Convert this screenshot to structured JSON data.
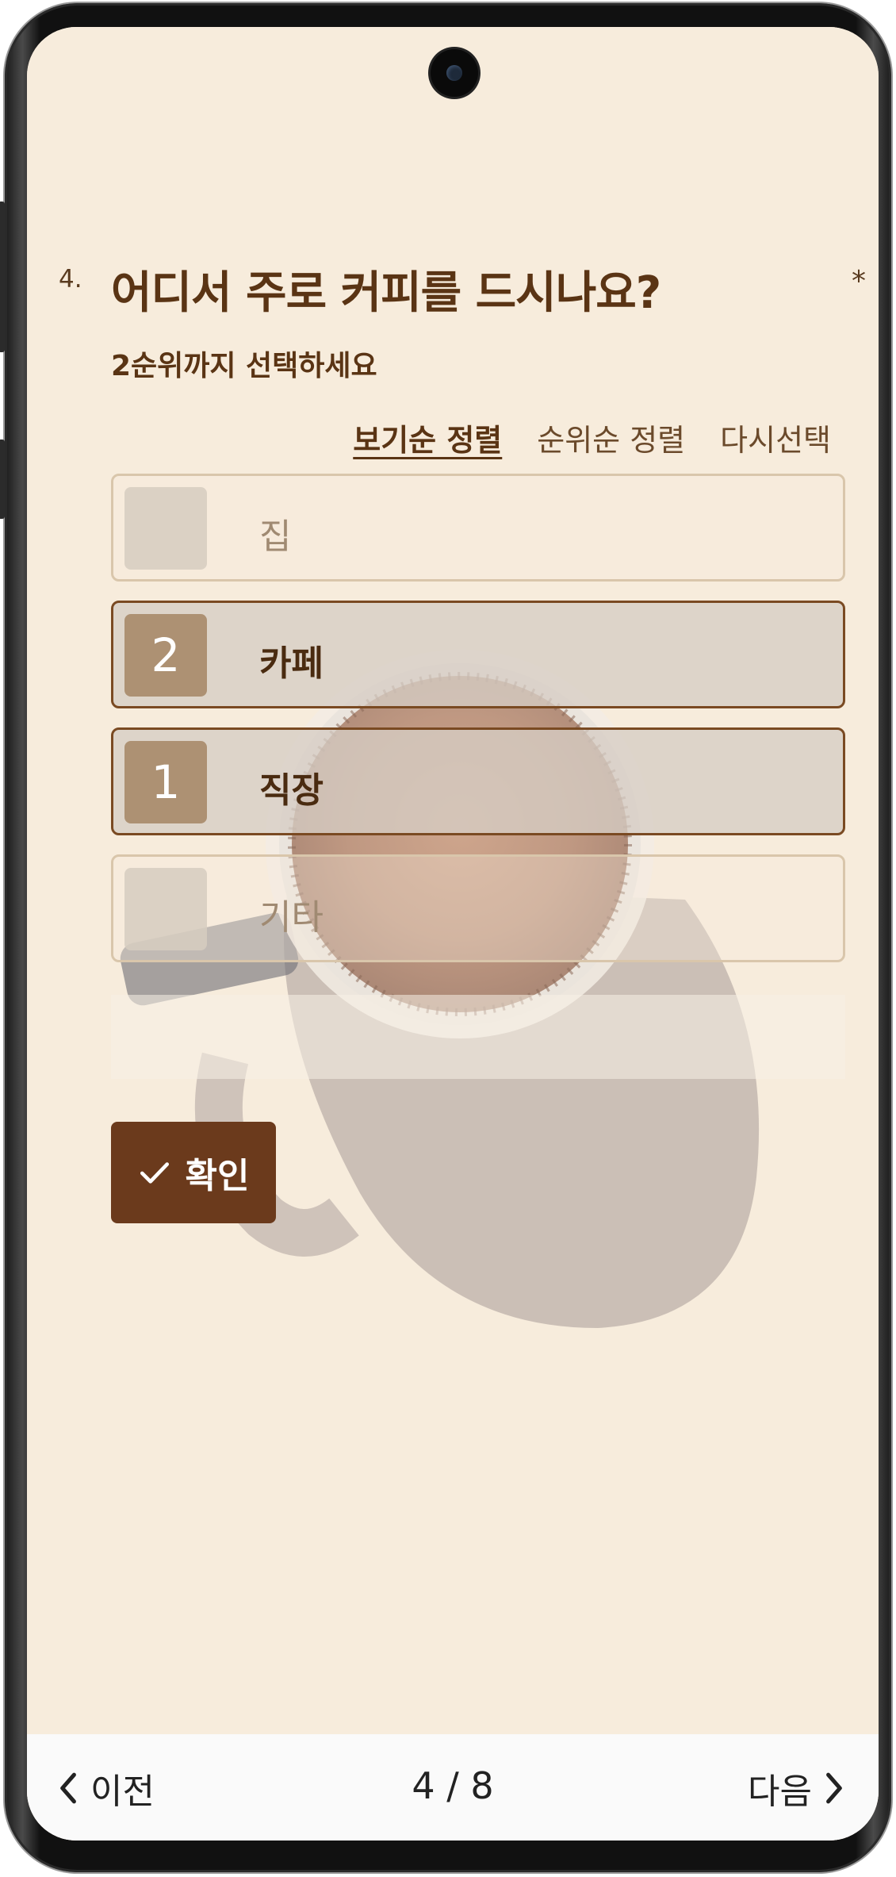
{
  "question": {
    "number": "4.",
    "title": "어디서 주로 커피를 드시나요?",
    "required_mark": "*",
    "hint": "2순위까지 선택하세요"
  },
  "sort": {
    "view_order": "보기순 정렬",
    "rank_order": "순위순 정렬",
    "reset": "다시선택"
  },
  "options": [
    {
      "label": "집",
      "rank": "",
      "selected": false
    },
    {
      "label": "카페",
      "rank": "2",
      "selected": true
    },
    {
      "label": "직장",
      "rank": "1",
      "selected": true
    },
    {
      "label": "기타",
      "rank": "",
      "selected": false
    }
  ],
  "confirm": {
    "label": "확인",
    "icon": "check-icon"
  },
  "nav": {
    "prev": "이전",
    "next": "다음",
    "page": "4 / 8"
  },
  "colors": {
    "background": "#f7ecdc",
    "accent": "#6b3a1c",
    "title": "#5a3414",
    "rank_box": "#ad9173"
  }
}
